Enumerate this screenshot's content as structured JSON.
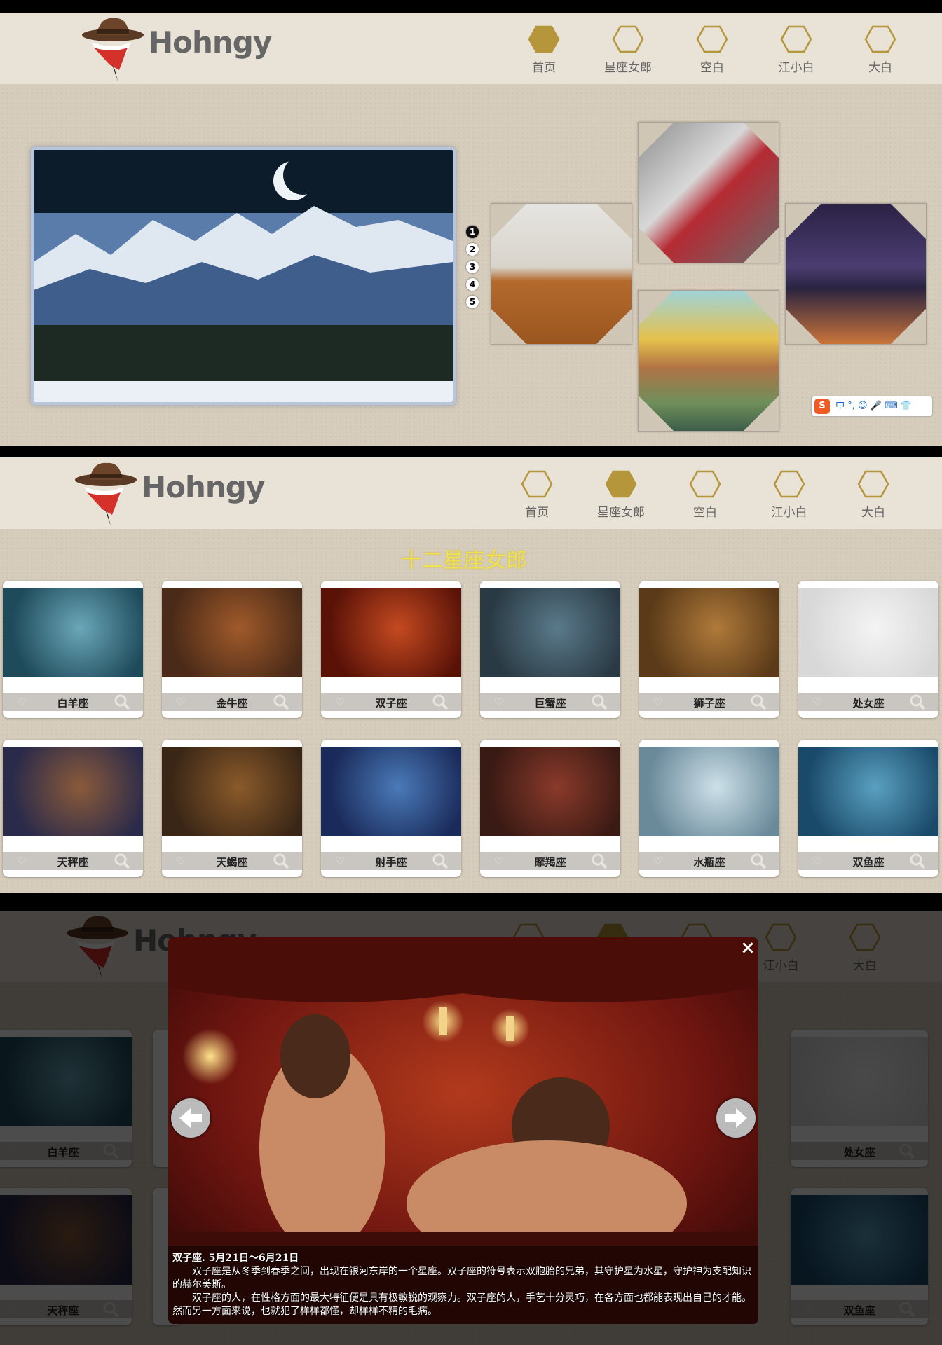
{
  "logo": {
    "text": "Hohngy"
  },
  "nav": [
    {
      "label": "首页"
    },
    {
      "label": "星座女郎"
    },
    {
      "label": "空白"
    },
    {
      "label": "江小白"
    },
    {
      "label": "大白"
    }
  ],
  "nav_active": {
    "panel1": 0,
    "panel2": 1,
    "panel3": 1
  },
  "colors": {
    "accent_gold": "#b5963a",
    "header_bg": "#e9e2d6",
    "page_bg": "#d6ccbb",
    "zodiac_title": "#f0e24c"
  },
  "slider": {
    "dots": [
      "1",
      "2",
      "3",
      "4",
      "5"
    ],
    "active_dot": 0
  },
  "ime_bar": {
    "label": "S",
    "items": "中 °, ☺ 🎤 ⌨ 👕"
  },
  "zodiac_section": {
    "title": "十二星座女郎",
    "cards": [
      {
        "name": "白羊座"
      },
      {
        "name": "金牛座"
      },
      {
        "name": "双子座"
      },
      {
        "name": "巨蟹座"
      },
      {
        "name": "狮子座"
      },
      {
        "name": "处女座"
      },
      {
        "name": "天秤座"
      },
      {
        "name": "天蝎座"
      },
      {
        "name": "射手座"
      },
      {
        "name": "摩羯座"
      },
      {
        "name": "水瓶座"
      },
      {
        "name": "双鱼座"
      }
    ],
    "heart_icon": "♡"
  },
  "lightbox": {
    "close": "×",
    "caption_title": "双子座. 5月21日～6月21日",
    "caption_p1": "双子座是从冬季到春季之间，出现在银河东岸的一个星座。双子座的符号表示双胞胎的兄弟，其守护星为水星，守护神为支配知识的赫尔美斯。",
    "caption_p2": "双子座的人，在性格方面的最大特征便是具有极敏锐的观察力。双子座的人，手艺十分灵巧，在各方面也都能表现出自己的才能。然而另一方面来说，也就犯了样样都懂，却样样不精的毛病。"
  },
  "dim_cards": [
    {
      "name": "白羊座"
    },
    {
      "name": "处女座"
    },
    {
      "name": "天秤座"
    },
    {
      "name": "双鱼座"
    }
  ]
}
